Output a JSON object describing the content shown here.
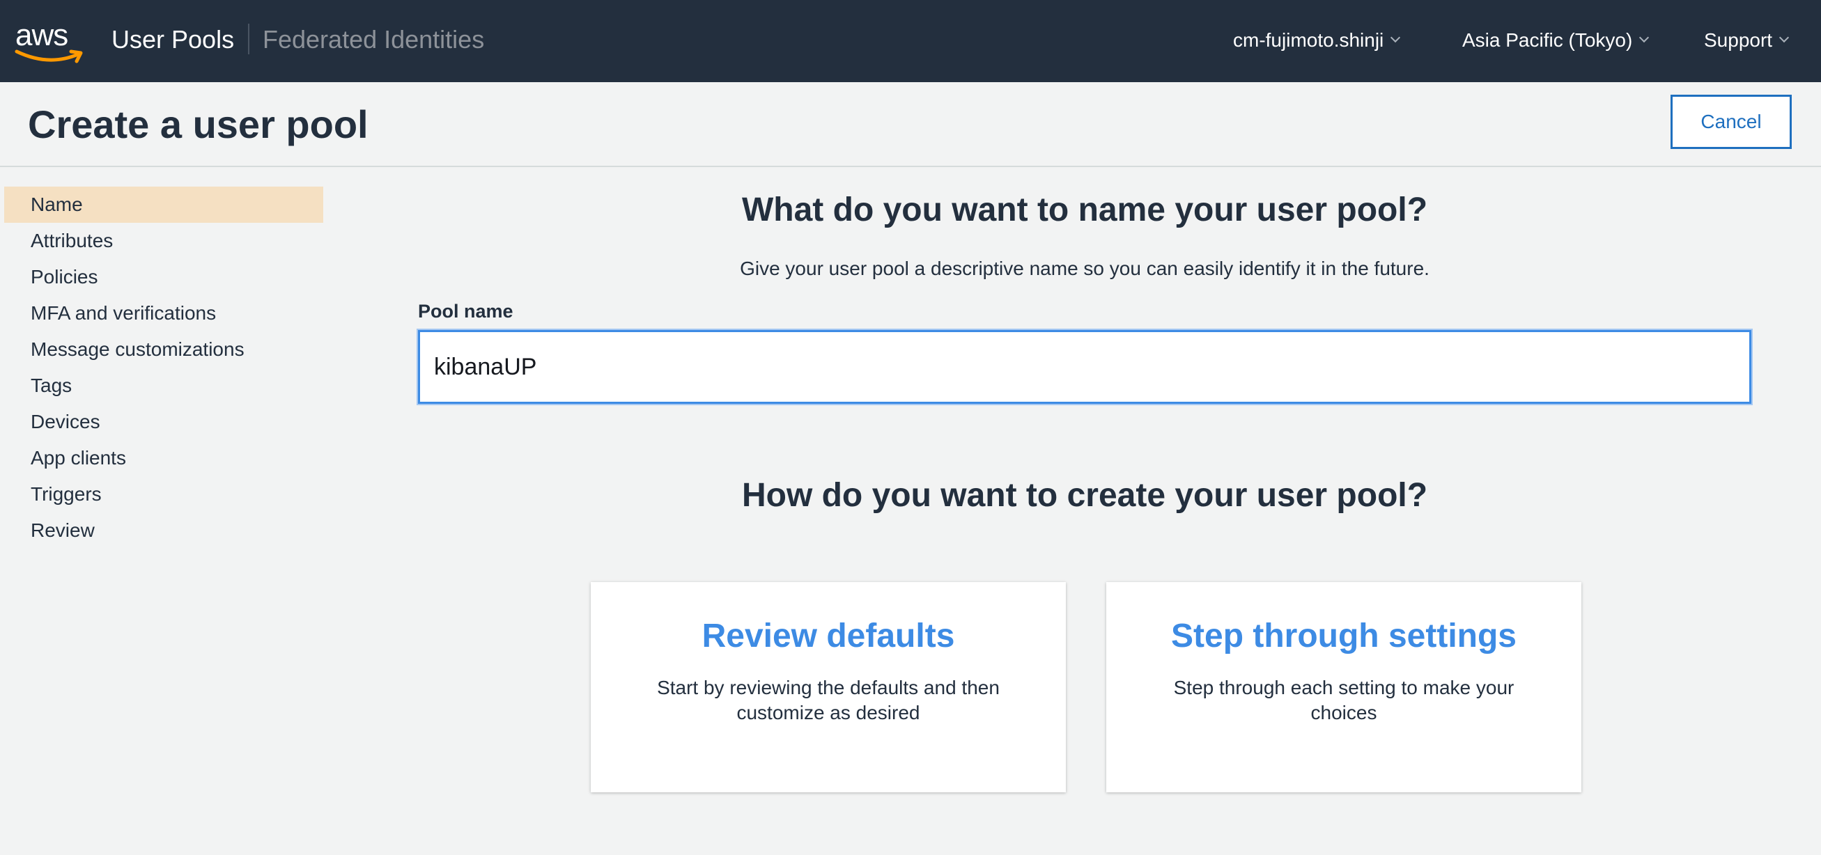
{
  "topbar": {
    "logo_text": "aws",
    "user_pools": "User Pools",
    "federated_identities": "Federated Identities",
    "account": "cm-fujimoto.shinji",
    "region": "Asia Pacific (Tokyo)",
    "support": "Support"
  },
  "header": {
    "title": "Create a user pool",
    "cancel_label": "Cancel"
  },
  "sidebar": {
    "items": [
      {
        "label": "Name",
        "active": true
      },
      {
        "label": "Attributes"
      },
      {
        "label": "Policies"
      },
      {
        "label": "MFA and verifications"
      },
      {
        "label": "Message customizations"
      },
      {
        "label": "Tags"
      },
      {
        "label": "Devices"
      },
      {
        "label": "App clients"
      },
      {
        "label": "Triggers"
      },
      {
        "label": "Review"
      }
    ]
  },
  "main": {
    "name_heading": "What do you want to name your user pool?",
    "name_subtext": "Give your user pool a descriptive name so you can easily identify it in the future.",
    "pool_name_label": "Pool name",
    "pool_name_value": "kibanaUP",
    "create_heading": "How do you want to create your user pool?",
    "options": [
      {
        "title": "Review defaults",
        "description": "Start by reviewing the defaults and then customize as desired"
      },
      {
        "title": "Step through settings",
        "description": "Step through each setting to make your choices"
      }
    ]
  },
  "colors": {
    "navbar": "#232f3e",
    "accent_blue": "#3d8be4",
    "active_sidebar": "#f5e0c2",
    "aws_orange": "#ff9900"
  }
}
